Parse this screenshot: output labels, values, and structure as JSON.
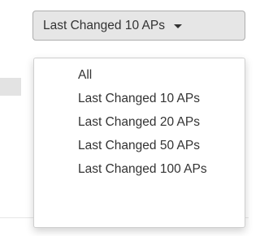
{
  "dropdown": {
    "selected_label": "Last Changed 10 APs",
    "caret_icon": "caret-down-icon",
    "options": [
      {
        "label": "All"
      },
      {
        "label": "Last Changed 10 APs"
      },
      {
        "label": "Last Changed 20 APs"
      },
      {
        "label": "Last Changed 50 APs"
      },
      {
        "label": "Last Changed 100 APs"
      }
    ]
  },
  "colors": {
    "button_background": "#e6e6e6",
    "button_border": "#adadad",
    "text": "#333333",
    "menu_border": "#cfcfcf"
  }
}
